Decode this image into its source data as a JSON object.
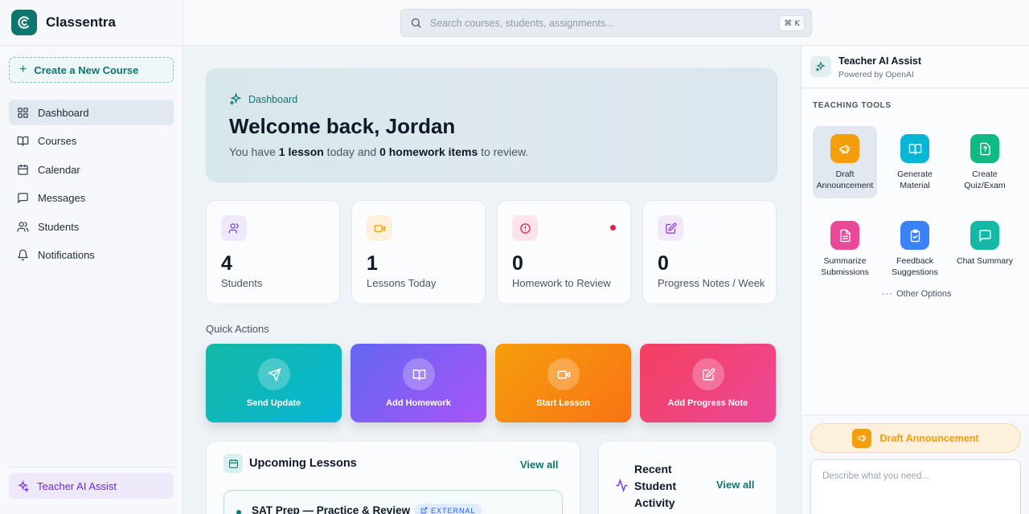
{
  "app": {
    "name": "Classentra"
  },
  "sidebar": {
    "create_label": "Create a New Course",
    "items": [
      {
        "label": "Dashboard",
        "icon": "grid-icon"
      },
      {
        "label": "Courses",
        "icon": "book-icon"
      },
      {
        "label": "Calendar",
        "icon": "calendar-icon"
      },
      {
        "label": "Messages",
        "icon": "message-icon"
      },
      {
        "label": "Students",
        "icon": "users-icon"
      },
      {
        "label": "Notifications",
        "icon": "bell-icon"
      }
    ],
    "active": "Dashboard",
    "ai_label": "Teacher AI Assist"
  },
  "search": {
    "placeholder": "Search courses, students, assignments...",
    "shortcut": "⌘ K"
  },
  "welcome": {
    "crumb": "Dashboard",
    "title": "Welcome back, Jordan",
    "text_1": "You have ",
    "lessons": "1 lesson",
    "text_2": " today and ",
    "homework": "0 homework items",
    "text_3": " to review."
  },
  "stats": [
    {
      "value": "4",
      "label": "Students",
      "icon": "users-icon",
      "color": "#7c3aed"
    },
    {
      "value": "1",
      "label": "Lessons Today",
      "icon": "video-icon",
      "color": "#f59e0b"
    },
    {
      "value": "0",
      "label": "Homework to Review",
      "icon": "alert-circle-icon",
      "color": "#e11d48"
    },
    {
      "value": "0",
      "label": "Progress Notes / Week",
      "icon": "edit-note-icon",
      "color": "#9333ea"
    }
  ],
  "quick_actions": {
    "title": "Quick Actions",
    "items": [
      {
        "label": "Send Update",
        "icon": "send-icon"
      },
      {
        "label": "Add Homework",
        "icon": "book-icon"
      },
      {
        "label": "Start Lesson",
        "icon": "video-icon"
      },
      {
        "label": "Add Progress Note",
        "icon": "edit-note-icon"
      }
    ]
  },
  "upcoming": {
    "title": "Upcoming Lessons",
    "view_all": "View all",
    "lesson_title": "SAT Prep — Practice & Review",
    "badge": "EXTERNAL"
  },
  "recent": {
    "title": "Recent Student Activity",
    "view_all": "View all"
  },
  "assistant": {
    "title": "Teacher AI Assist",
    "subtitle": "Powered by OpenAI",
    "section": "TEACHING TOOLS",
    "tools": [
      {
        "label": "Draft Announcement",
        "icon": "megaphone-icon",
        "color": "#f59e0b"
      },
      {
        "label": "Generate Material",
        "icon": "book-icon",
        "color": "#06b6d4"
      },
      {
        "label": "Create Quiz/Exam",
        "icon": "quiz-icon",
        "color": "#10b981"
      },
      {
        "label": "Summarize Submissions",
        "icon": "document-icon",
        "color": "#ec4899"
      },
      {
        "label": "Feedback Suggestions",
        "icon": "clipboard-check-icon",
        "color": "#3b82f6"
      },
      {
        "label": "Chat Summary",
        "icon": "chat-icon",
        "color": "#14b8a6"
      }
    ],
    "other_options": "Other Options",
    "selected_tool": "Draft Announcement",
    "prompt_placeholder": "Describe what you need..."
  }
}
